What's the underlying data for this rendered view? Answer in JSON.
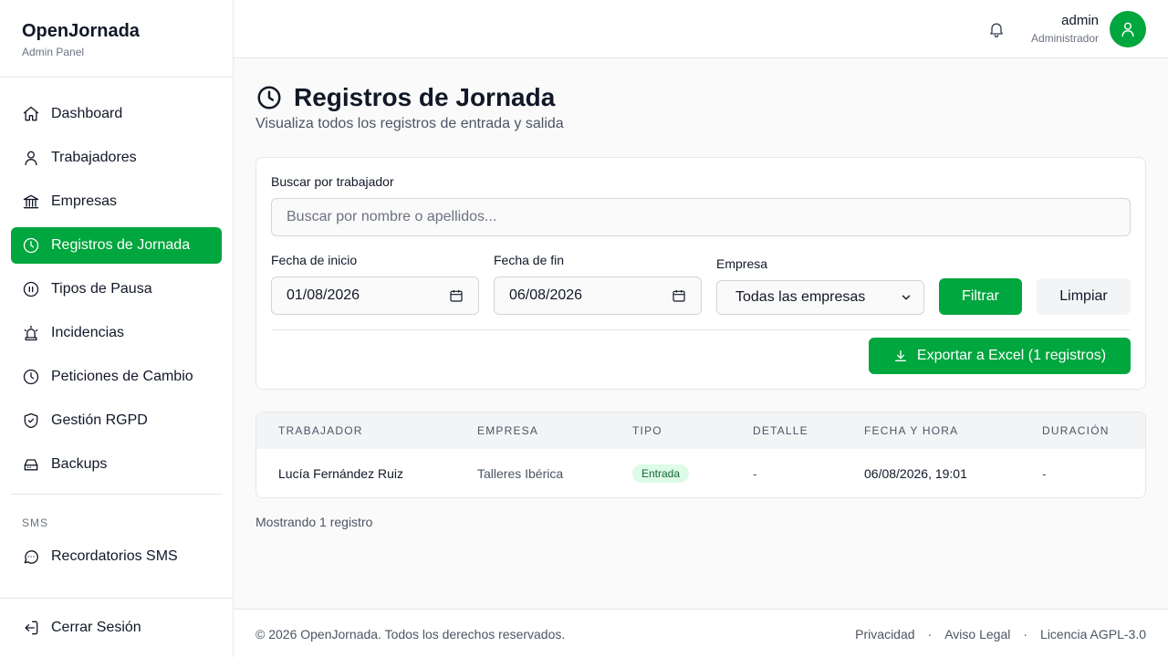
{
  "brand": {
    "title": "OpenJornada",
    "subtitle": "Admin Panel"
  },
  "sidebar": {
    "items": [
      {
        "label": "Dashboard",
        "icon": "home-icon"
      },
      {
        "label": "Trabajadores",
        "icon": "user-icon"
      },
      {
        "label": "Empresas",
        "icon": "bank-icon"
      },
      {
        "label": "Registros de Jornada",
        "icon": "clock-icon",
        "active": true
      },
      {
        "label": "Tipos de Pausa",
        "icon": "pause-circle-icon"
      },
      {
        "label": "Incidencias",
        "icon": "siren-icon"
      },
      {
        "label": "Peticiones de Cambio",
        "icon": "clock-icon"
      },
      {
        "label": "Gestión RGPD",
        "icon": "shield-check-icon"
      },
      {
        "label": "Backups",
        "icon": "hard-drive-icon"
      }
    ],
    "section_label": "SMS",
    "sms_item": {
      "label": "Recordatorios SMS",
      "icon": "message-dots-icon"
    },
    "logout": {
      "label": "Cerrar Sesión",
      "icon": "logout-icon"
    }
  },
  "header": {
    "user_name": "admin",
    "user_role": "Administrador",
    "accent": "#00a63e"
  },
  "page": {
    "title": "Registros de Jornada",
    "subtitle": "Visualiza todos los registros de entrada y salida"
  },
  "filters": {
    "search_label": "Buscar por trabajador",
    "search_placeholder": "Buscar por nombre o apellidos...",
    "start_label": "Fecha de inicio",
    "start_value": "01/08/2026",
    "end_label": "Fecha de fin",
    "end_value": "06/08/2026",
    "company_label": "Empresa",
    "company_value": "Todas las empresas",
    "filter_button": "Filtrar",
    "clear_button": "Limpiar",
    "export_button": "Exportar a Excel (1 registros)"
  },
  "table": {
    "headers": [
      "TRABAJADOR",
      "EMPRESA",
      "TIPO",
      "DETALLE",
      "FECHA Y HORA",
      "DURACIÓN"
    ],
    "rows": [
      {
        "trabajador": "Lucía Fernández Ruiz",
        "empresa": "Talleres Ibérica",
        "tipo": "Entrada",
        "detalle": "-",
        "fecha": "06/08/2026, 19:01",
        "duracion": "-"
      }
    ],
    "count_text": "Mostrando 1 registro"
  },
  "footer": {
    "copyright": "© 2026 OpenJornada. Todos los derechos reservados.",
    "links": [
      "Privacidad",
      "Aviso Legal",
      "Licencia AGPL-3.0"
    ],
    "separator": "·"
  }
}
